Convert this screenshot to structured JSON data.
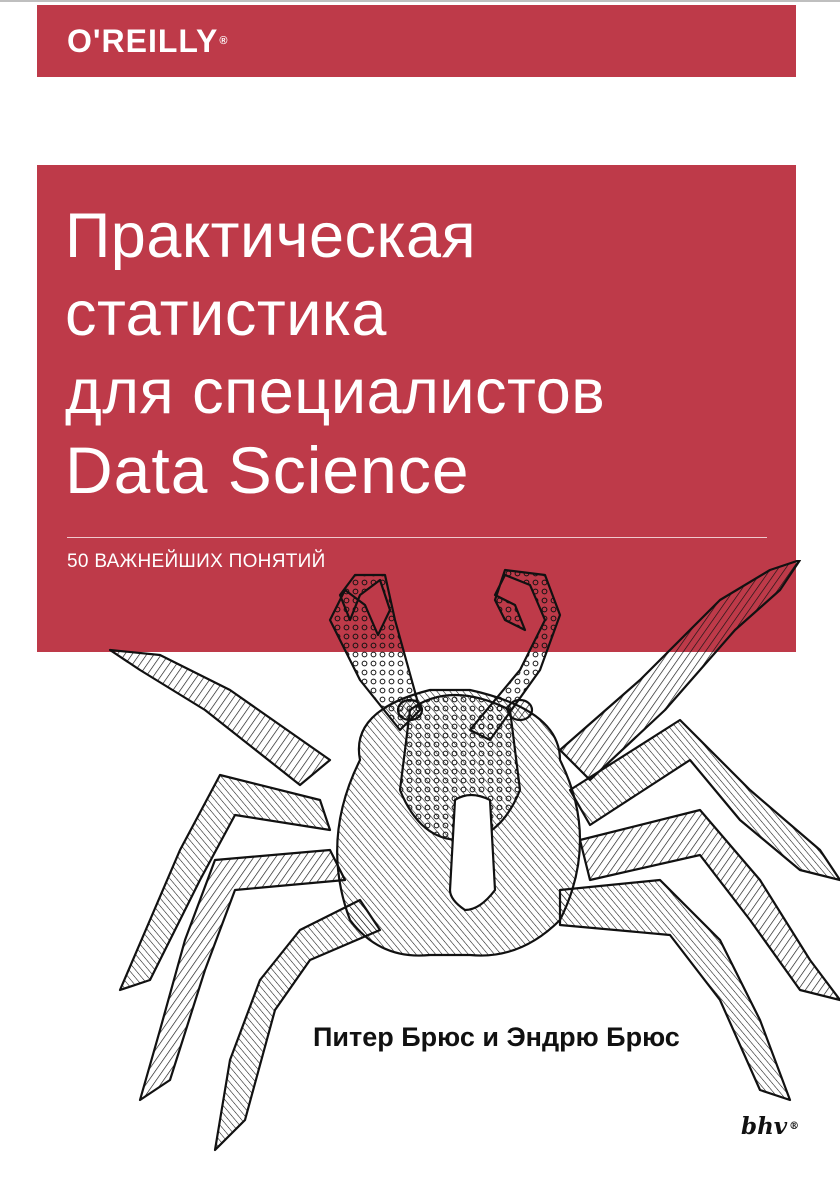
{
  "publisher": {
    "logo_text": "O'REILLY",
    "registered_mark": "®"
  },
  "title": {
    "line1": "Практическая",
    "line2": "статистика",
    "line3": "для специалистов",
    "line4": "Data Science"
  },
  "subtitle": "50 ВАЖНЕЙШИХ ПОНЯТИЙ",
  "authors": "Питер Брюс и Эндрю Брюс",
  "imprint": {
    "logo_text": "bhv",
    "registered_mark": "®"
  },
  "colors": {
    "brand_red": "#be3a49",
    "ink": "#111111",
    "page": "#ffffff"
  },
  "illustration": "crab-engraving"
}
